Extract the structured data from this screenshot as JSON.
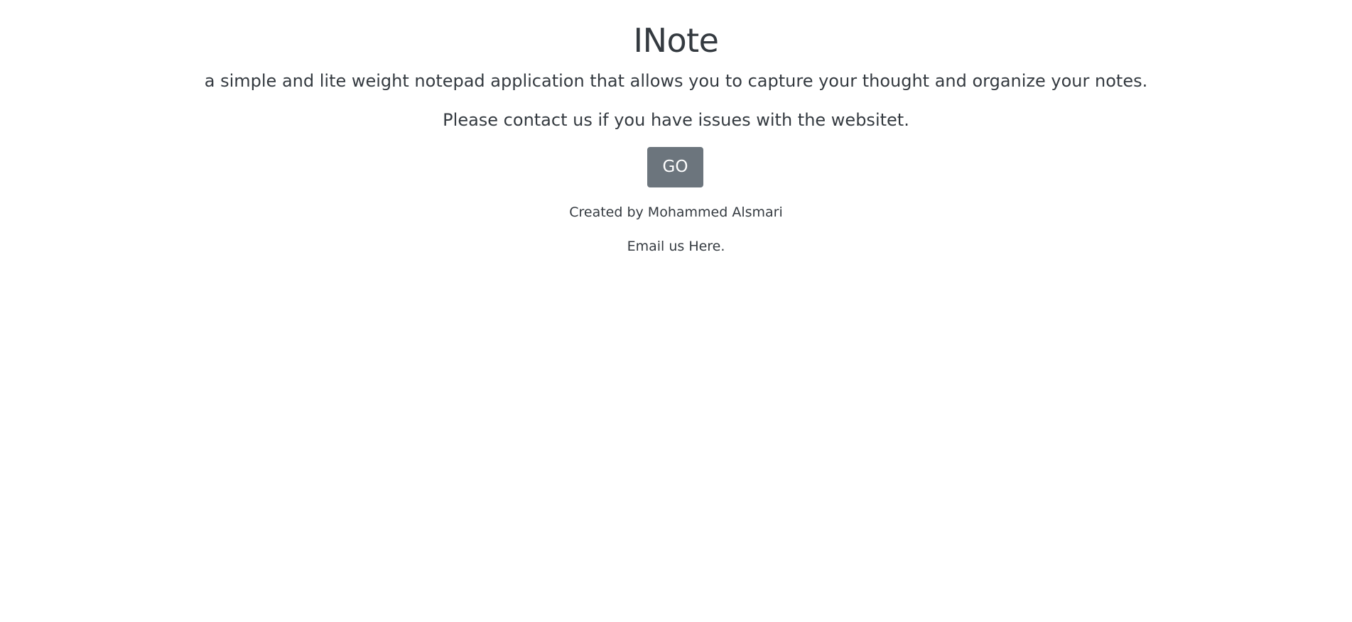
{
  "header": {
    "title": "INote",
    "tagline": "a simple and lite weight notepad application that allows you to capture your thought and organize your notes."
  },
  "main": {
    "contact_text": "Please contact us if you have issues with the websitet.",
    "go_button_label": "GO"
  },
  "footer": {
    "credit": "Created by Mohammed Alsmari",
    "email_prefix": "Email us ",
    "email_link": "Here."
  },
  "colors": {
    "text": "#343a40",
    "button_bg": "#6c757d",
    "button_text": "#ffffff",
    "background": "#ffffff"
  }
}
